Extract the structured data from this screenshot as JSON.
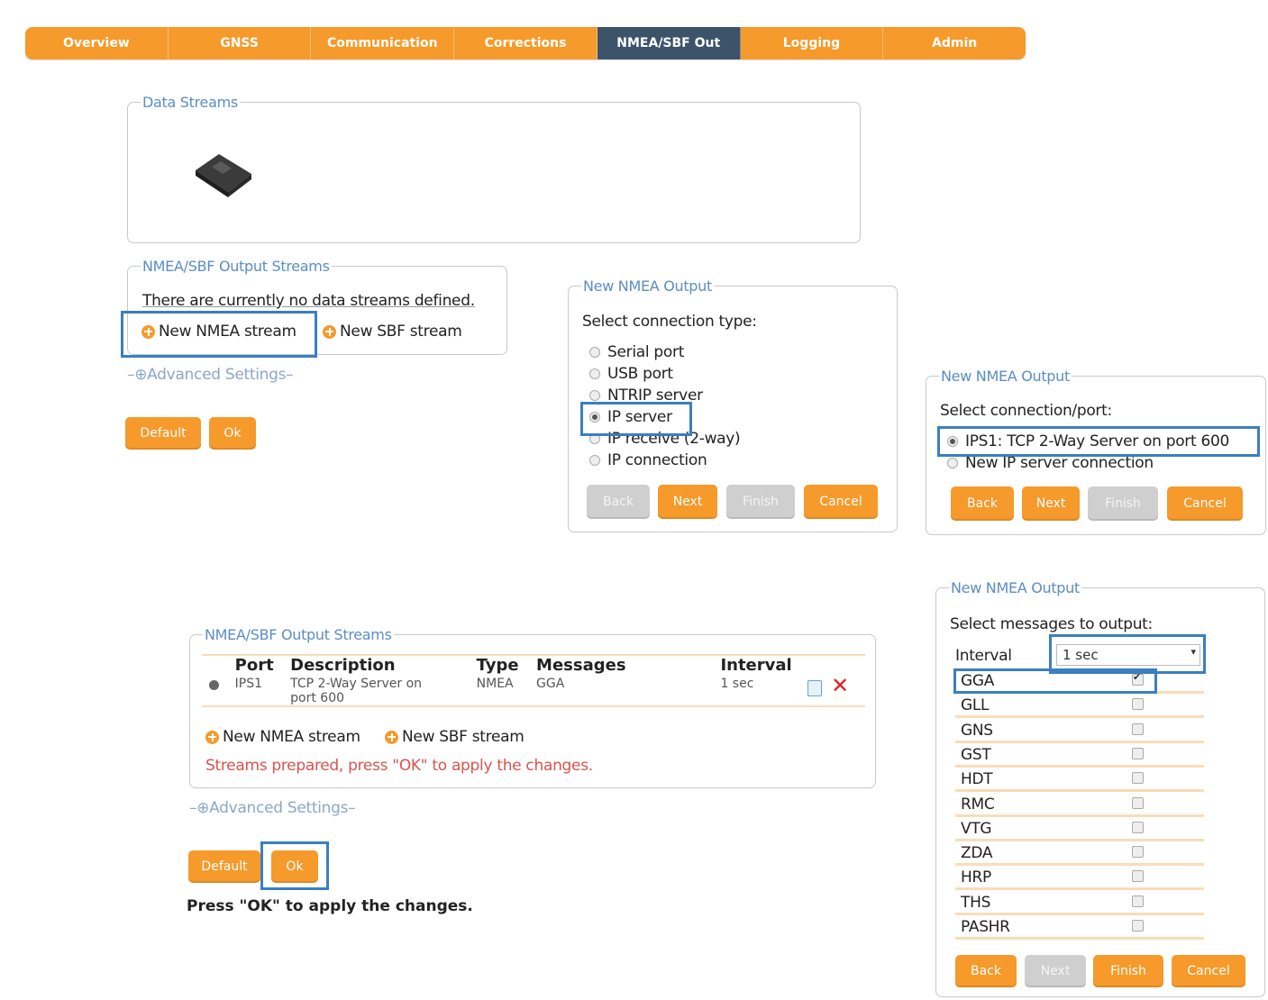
{
  "nav": {
    "tabs": [
      "Overview",
      "GNSS",
      "Communication",
      "Corrections",
      "NMEA/SBF Out",
      "Logging",
      "Admin"
    ],
    "active_index": 4
  },
  "data_streams": {
    "legend": "Data Streams",
    "device_icon": "receiver-device-icon"
  },
  "output_streams_empty": {
    "legend": "NMEA/SBF Output Streams",
    "message": "There are currently no data streams defined.",
    "new_nmea": "New NMEA stream",
    "new_sbf": "New SBF stream",
    "advanced": "Advanced Settings",
    "default_btn": "Default",
    "ok_btn": "Ok"
  },
  "wizard_connection_type": {
    "legend": "New NMEA Output",
    "prompt": "Select connection type:",
    "options": [
      "Serial port",
      "USB port",
      "NTRIP server",
      "IP server",
      "IP receive (2-way)",
      "IP connection"
    ],
    "selected_index": 3,
    "buttons": {
      "back": "Back",
      "next": "Next",
      "finish": "Finish",
      "cancel": "Cancel"
    }
  },
  "wizard_port": {
    "legend": "New NMEA Output",
    "prompt": "Select connection/port:",
    "options": [
      "IPS1: TCP 2-Way Server on port 600",
      "New IP server connection"
    ],
    "selected_index": 0,
    "buttons": {
      "back": "Back",
      "next": "Next",
      "finish": "Finish",
      "cancel": "Cancel"
    }
  },
  "wizard_messages": {
    "legend": "New NMEA Output",
    "prompt": "Select messages to output:",
    "interval_label": "Interval",
    "interval_value": "1 sec",
    "messages": [
      {
        "name": "GGA",
        "checked": true
      },
      {
        "name": "GLL",
        "checked": false
      },
      {
        "name": "GNS",
        "checked": false
      },
      {
        "name": "GST",
        "checked": false
      },
      {
        "name": "HDT",
        "checked": false
      },
      {
        "name": "RMC",
        "checked": false
      },
      {
        "name": "VTG",
        "checked": false
      },
      {
        "name": "ZDA",
        "checked": false
      },
      {
        "name": "HRP",
        "checked": false
      },
      {
        "name": "THS",
        "checked": false
      },
      {
        "name": "PASHR",
        "checked": false
      }
    ],
    "buttons": {
      "back": "Back",
      "next": "Next",
      "finish": "Finish",
      "cancel": "Cancel"
    }
  },
  "output_streams_defined": {
    "legend": "NMEA/SBF Output Streams",
    "columns": [
      "Port",
      "Description",
      "Type",
      "Messages",
      "Interval"
    ],
    "rows": [
      {
        "port": "IPS1",
        "description_line1": "TCP 2-Way Server on",
        "description_line2": "port 600",
        "type": "NMEA",
        "messages": "GGA",
        "interval": "1 sec"
      }
    ],
    "new_nmea": "New NMEA stream",
    "new_sbf": "New SBF stream",
    "status": "Streams prepared, press \"OK\" to apply the changes.",
    "advanced": "Advanced Settings",
    "default_btn": "Default",
    "ok_btn": "Ok",
    "instruction": "Press \"OK\" to apply the changes."
  },
  "colors": {
    "accent": "#f59a2b",
    "active_tab": "#3d5369",
    "highlight": "#3a7fc1",
    "legend": "#5a8ec4",
    "status_red": "#d9534f"
  }
}
